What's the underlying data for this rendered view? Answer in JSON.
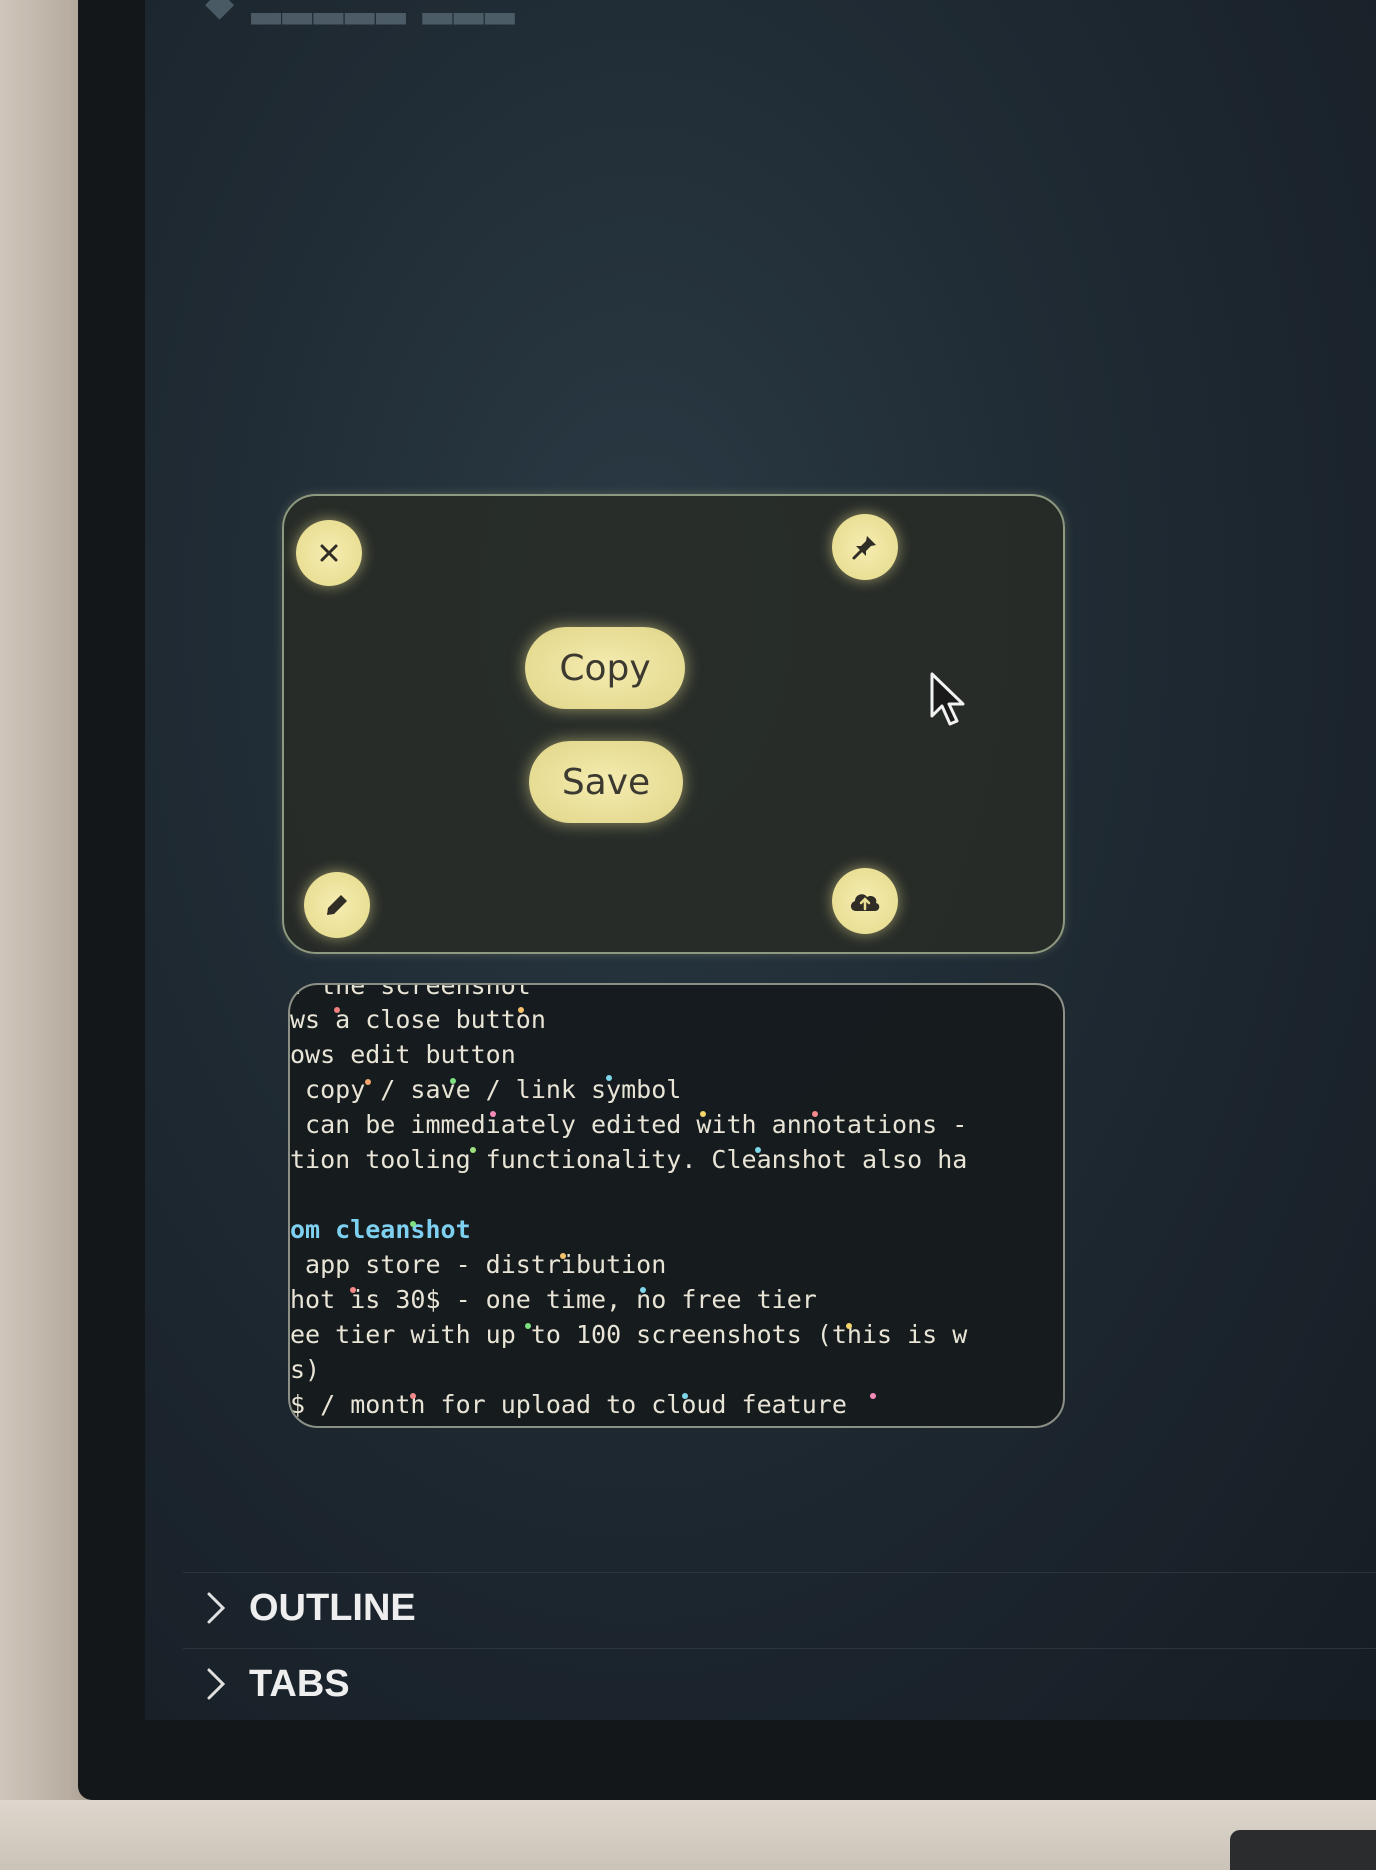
{
  "capture_overlay": {
    "close_icon": "close-icon",
    "pin_icon": "pin-icon",
    "edit_icon": "pencil-icon",
    "upload_icon": "cloud-upload-icon",
    "copy_label": "Copy",
    "save_label": "Save"
  },
  "notes": {
    "lines": [
      ". the screenshot",
      "ws a close button",
      "ows edit button",
      " copy / save / link symbol",
      " can be immediately edited with annotations -",
      "tion tooling functionality. Cleanshot also ha",
      "",
      "om cleanshot",
      " app store - distribution",
      "hot is 30$ - one time, no free tier",
      "ee tier with up to 100 screenshots (this is w",
      "s)",
      "$ / month for upload to cloud feature"
    ]
  },
  "sidebar": {
    "outline_label": "OUTLINE",
    "tabs_label": "TABS"
  },
  "colors": {
    "button_fill": "#eadf95",
    "screen_bg": "#1f2a33",
    "heading_text": "#7ed0f0"
  }
}
